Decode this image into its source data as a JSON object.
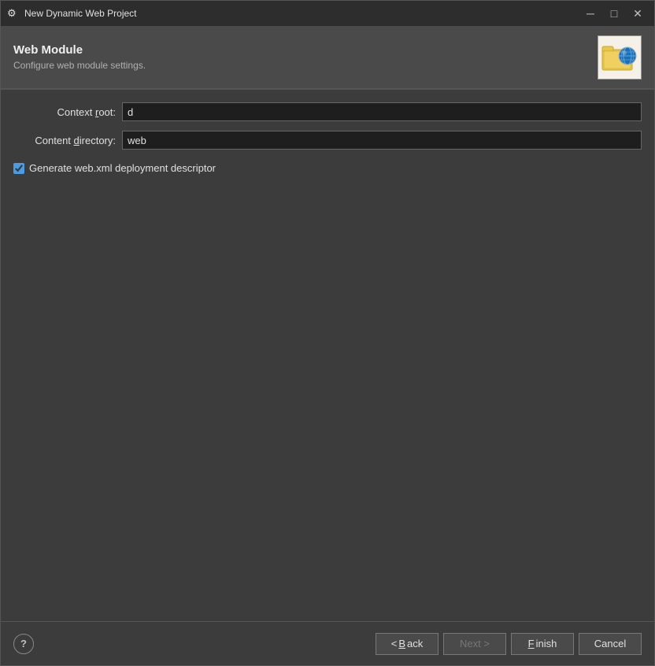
{
  "window": {
    "title": "New Dynamic Web Project",
    "icon": "⚙"
  },
  "titlebar": {
    "minimize_label": "─",
    "maximize_label": "□",
    "close_label": "✕"
  },
  "header": {
    "title": "Web Module",
    "subtitle": "Configure web module settings."
  },
  "form": {
    "context_root_label": "Context root:",
    "context_root_value": "d",
    "content_directory_label": "Content directory:",
    "content_directory_value": "web",
    "checkbox_label": "Generate web.xml deployment descriptor",
    "checkbox_checked": true
  },
  "footer": {
    "help_label": "?",
    "back_label": "< Back",
    "next_label": "Next >",
    "finish_label": "Finish",
    "cancel_label": "Cancel"
  }
}
